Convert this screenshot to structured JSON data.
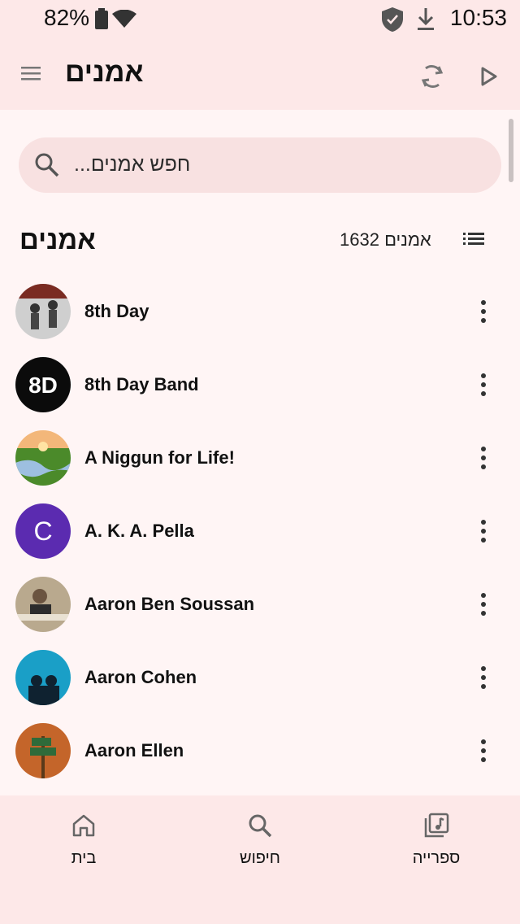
{
  "status_bar": {
    "battery_percent": "82%",
    "time": "10:53",
    "icons": [
      "battery-icon",
      "wifi-icon",
      "shield-icon",
      "download-icon"
    ]
  },
  "app_bar": {
    "title": "אמנים",
    "icons": [
      "menu-icon",
      "sync-icon",
      "play-icon"
    ]
  },
  "search": {
    "placeholder": "חפש אמנים..."
  },
  "section": {
    "title": "אמנים",
    "count": "1632 אמנים"
  },
  "artists": [
    {
      "name": "8th Day",
      "avatar": "photo"
    },
    {
      "name": "8th Day Band",
      "avatar": "8D"
    },
    {
      "name": "A Niggun for Life!",
      "avatar": "landscape"
    },
    {
      "name": "A. K. A. Pella",
      "avatar": "C"
    },
    {
      "name": "Aaron Ben Soussan",
      "avatar": "photo"
    },
    {
      "name": "Aaron Cohen",
      "avatar": "photo"
    },
    {
      "name": "Aaron Ellen",
      "avatar": "photo"
    }
  ],
  "bottom_nav": {
    "home": "בית",
    "search": "חיפוש",
    "library": "ספרייה"
  },
  "colors": {
    "bar_bg": "#fde8e8",
    "page_bg": "#fff5f5",
    "search_bg": "#f8e1e1",
    "letter_avatar": "#5b2bb0"
  }
}
